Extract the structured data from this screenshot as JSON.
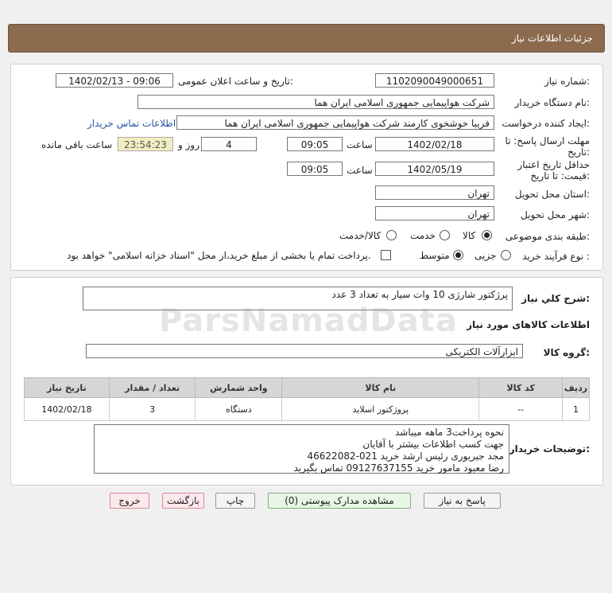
{
  "header": {
    "title": "جزئیات اطلاعات نیاز"
  },
  "form": {
    "need_number_label": "شماره نیاز:",
    "need_number": "1102090049000651",
    "announce_label": "تاریخ و ساعت اعلان عمومی:",
    "announce_value": "1402/02/13 - 09:06",
    "buyer_org_label": "نام دستگاه خریدار:",
    "buyer_org": "شرکت هواپیمایی جمهوری اسلامی ایران هما",
    "requester_label": "ایجاد کننده درخواست:",
    "requester": "فریبا خوشخوی کارمند شرکت هواپیمایی جمهوری اسلامی ایران هما",
    "contact_link": "اطلاعات تماس خریدار",
    "deadline_label_1": "مهلت ارسال پاسخ: تا",
    "deadline_label_2": "تاریخ:",
    "deadline_date": "1402/02/18",
    "time_label": "ساعت",
    "deadline_time": "09:05",
    "days_value": "4",
    "days_label": "روز و",
    "remaining_time": "23:54:23",
    "remaining_label": "ساعت باقی مانده",
    "validity_label_1": "حداقل تاریخ اعتبار",
    "validity_label_2": "قیمت: تا تاریخ:",
    "validity_date": "1402/05/19",
    "validity_time": "09:05",
    "province_label": "استان محل تحویل:",
    "province": "تهران",
    "city_label": "شهر محل تحویل:",
    "city": "تهران",
    "category_label": "طبقه بندی موضوعی:",
    "category_options": [
      "کالا",
      "خدمت",
      "کالا/خدمت"
    ],
    "process_label": "نوع فرآیند خرید :",
    "process_options": [
      "جزیی",
      "متوسط"
    ],
    "payment_note": "پرداخت تمام یا بخشی از مبلغ خرید،از محل \"اسناد خزانه اسلامی\" خواهد بود."
  },
  "summary": {
    "label": "شرح کلي نياز:",
    "value": "پرژکتور شارژی 10 وات سیار به تعداد 3 عدد"
  },
  "goods": {
    "section_title": "اطلاعات کالاهای مورد نياز",
    "group_label": "گروه کالا:",
    "group_value": "ابزارآلات الکتریکی",
    "columns": [
      "ردیف",
      "کد کالا",
      "نام کالا",
      "واحد شمارش",
      "تعداد / مقدار",
      "تاریخ نیاز"
    ],
    "rows": [
      [
        "1",
        "--",
        "پروژکتور اسلاید",
        "دستگاه",
        "3",
        "1402/02/18"
      ]
    ]
  },
  "notes": {
    "label": "توضیحات خریدار:",
    "lines": [
      "نحوه پرداخت3 ماهه میباشد",
      "جهت کسب اطلاعات بیشتر با آقایان",
      "مجد جیریوری رئیس ارشد خرید 021-46622082",
      "رضا معبود  مامور خرید 09127637155 تماس بگیرید"
    ]
  },
  "buttons": {
    "reply": "پاسخ به نیاز",
    "attachments": "مشاهده مدارک پیوستی (0)",
    "print": "چاپ",
    "back": "بازگشت",
    "exit": "خروج"
  }
}
